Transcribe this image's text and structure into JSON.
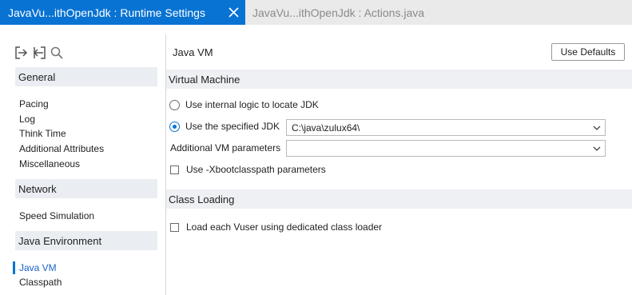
{
  "tabs": {
    "active_title": "JavaVu...ithOpenJdk : Runtime Settings",
    "inactive_title": "JavaVu...ithOpenJdk : Actions.java"
  },
  "toolbar": {
    "icons": [
      "import-icon",
      "export-icon",
      "search-icon"
    ]
  },
  "sidebar": {
    "sections": [
      {
        "title": "General",
        "items": [
          "Pacing",
          "Log",
          "Think Time",
          "Additional Attributes",
          "Miscellaneous"
        ]
      },
      {
        "title": "Network",
        "items": [
          "Speed Simulation"
        ]
      },
      {
        "title": "Java Environment",
        "items": [
          "Java VM",
          "Classpath"
        ]
      }
    ],
    "selected_item": "Java VM"
  },
  "main": {
    "title": "Java VM",
    "use_defaults_label": "Use Defaults",
    "virtual_machine": {
      "header": "Virtual Machine",
      "radio_internal_label": "Use internal logic to locate JDK",
      "radio_internal_checked": false,
      "radio_specified_label": "Use the specified JDK",
      "radio_specified_checked": true,
      "jdk_path_value": "C:\\java\\zulux64\\",
      "additional_params_label": "Additional VM parameters",
      "additional_params_value": "",
      "xbootclasspath_label": "Use -Xbootclasspath parameters",
      "xbootclasspath_checked": false
    },
    "class_loading": {
      "header": "Class Loading",
      "dedicated_loader_label": "Load each Vuser using dedicated class loader",
      "dedicated_loader_checked": false
    }
  },
  "colors": {
    "accent": "#0873d3",
    "tabbar_bg": "#eaeaea",
    "section_bg": "#eaeef2",
    "group_bg": "#eef0f3"
  }
}
